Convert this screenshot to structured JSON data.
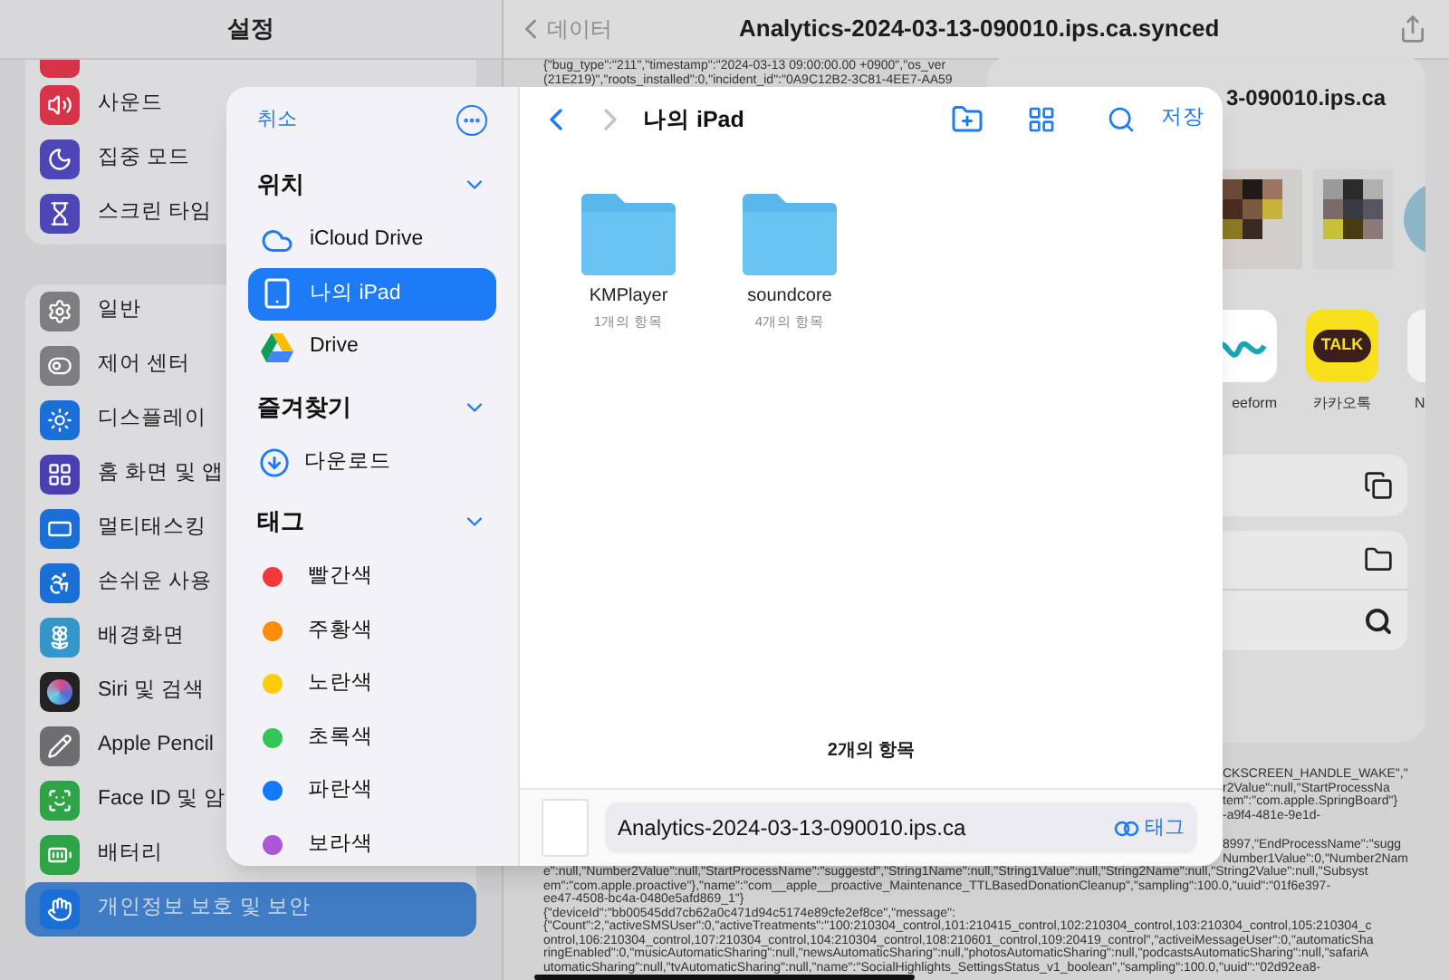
{
  "settings": {
    "title": "설정",
    "groups": [
      {
        "items": [
          {
            "label": "사운드",
            "selected": false
          },
          {
            "label": "집중 모드",
            "selected": false
          },
          {
            "label": "스크린 타임",
            "selected": false
          }
        ]
      },
      {
        "items": [
          {
            "label": "일반",
            "selected": false
          },
          {
            "label": "제어 센터",
            "selected": false
          },
          {
            "label": "디스플레이",
            "selected": false
          },
          {
            "label": "홈 화면 및 앱",
            "selected": false
          },
          {
            "label": "멀티태스킹",
            "selected": false
          },
          {
            "label": "손쉬운 사용",
            "selected": false
          },
          {
            "label": "배경화면",
            "selected": false
          },
          {
            "label": "Siri 및 검색",
            "selected": false
          },
          {
            "label": "Apple Pencil",
            "selected": false
          },
          {
            "label": "Face ID 및 암",
            "selected": false
          },
          {
            "label": "배터리",
            "selected": false
          },
          {
            "label": "개인정보 보호 및 보안",
            "selected": true
          }
        ]
      }
    ]
  },
  "document": {
    "back_label": "데이터",
    "title": "Analytics-2024-03-13-090010.ips.ca.synced",
    "log_top": [
      "{\"bug_type\":\"211\",\"timestamp\":\"2024-03-13 09:00:00.00 +0900\",\"os_ver",
      "(21E219)\",\"roots_installed\":0,\"incident_id\":\"0A9C12B2-3C81-4EE7-AA59"
    ],
    "log_right": [
      "CKSCREEN_HANDLE_WAKE\",\"",
      "r2Value\":null,\"StartProcessNa",
      "tem\":\"com.apple.SpringBoard\"}",
      "-a9f4-481e-9e1d-"
    ],
    "log_right_2": [
      "8997,\"EndProcessName\":\"sugg",
      "Number1Value\":0,\"Number2Nam"
    ],
    "log_bottom": [
      "e\":null,\"Number2Value\":null,\"StartProcessName\":\"suggestd\",\"String1Name\":null,\"String1Value\":null,\"String2Name\":null,\"String2Value\":null,\"Subsyst",
      "em\":\"com.apple.proactive\"},\"name\":\"com__apple__proactive_Maintenance_TTLBasedDonationCleanup\",\"sampling\":100.0,\"uuid\":\"01f6e397-",
      "ee47-4508-bc4a-0480e5afd869_1\"}",
      "{\"deviceId\":\"bb00545dd7cb62a0c471d94c5174e89cfe2ef8ce\",\"message\":",
      "{\"Count\":2,\"activeSMSUser\":0,\"activeTreatments\":\"100:210304_control,101:210415_control,102:210304_control,103:210304_control,105:210304_c",
      "ontrol,106:210304_control,107:210304_control,104:210304_control,108:210601_control,109:20419_control\",\"activeiMessageUser\":0,\"automaticSha",
      "ringEnabled\":0,\"musicAutomaticSharing\":null,\"newsAutomaticSharing\":null,\"photosAutomaticSharing\":null,\"podcastsAutomaticSharing\":null,\"safariA",
      "utomaticSharing\":null,\"tvAutomaticSharing\":null,\"name\":\"SocialHighlights_SettingsStatus_v1_boolean\",\"sampling\":100.0,\"uuid\":\"02d92ea8-"
    ]
  },
  "share_sheet": {
    "title": "3-090010.ips.ca",
    "apps": [
      {
        "label": "eeform"
      },
      {
        "label": "카카오톡",
        "logo_text": "TALK"
      },
      {
        "label": "N"
      }
    ]
  },
  "picker": {
    "cancel": "취소",
    "sections": [
      {
        "title": "위치",
        "kind": "locations",
        "items": [
          {
            "label": "iCloud Drive",
            "selected": false
          },
          {
            "label": "나의 iPad",
            "selected": true
          },
          {
            "label": "Drive",
            "selected": false
          }
        ]
      },
      {
        "title": "즐겨찾기",
        "kind": "favorites",
        "items": [
          {
            "label": "다운로드",
            "selected": false
          }
        ]
      },
      {
        "title": "태그",
        "kind": "tags",
        "items": [
          {
            "label": "빨간색",
            "color": "#f2383a"
          },
          {
            "label": "주황색",
            "color": "#fc8c0a"
          },
          {
            "label": "노란색",
            "color": "#fdcc0a"
          },
          {
            "label": "초록색",
            "color": "#32c557"
          },
          {
            "label": "파란색",
            "color": "#1279fc"
          },
          {
            "label": "보라색",
            "color": "#ac56dc"
          }
        ]
      }
    ],
    "folder_title": "나의 iPad",
    "save": "저장",
    "folders": [
      {
        "name": "KMPlayer",
        "count": "1개의 항목"
      },
      {
        "name": "soundcore",
        "count": "4개의 항목"
      }
    ],
    "item_count": "2개의 항목",
    "filename": "Analytics-2024-03-13-090010.ips.ca",
    "tag_button": "태그"
  }
}
